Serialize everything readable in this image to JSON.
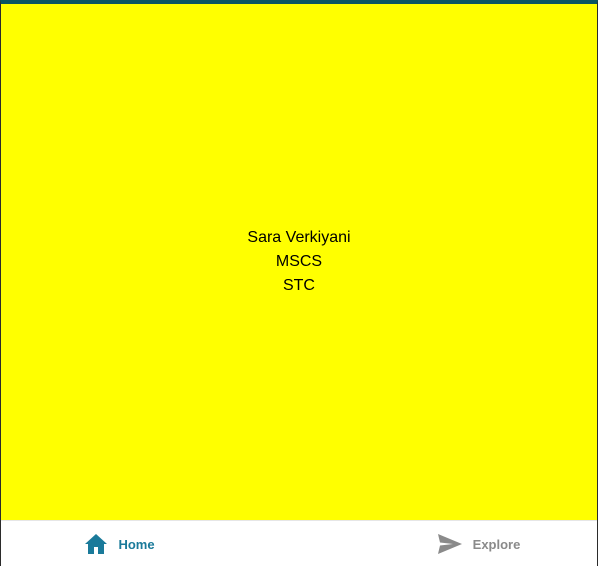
{
  "main": {
    "background_color": "#ffff00",
    "lines": [
      "Sara Verkiyani",
      "MSCS",
      "STC"
    ]
  },
  "tabbar": {
    "active_color": "#1a7a9a",
    "inactive_color": "#8a8a8a",
    "tabs": [
      {
        "label": "Home",
        "icon": "home-icon",
        "active": true
      },
      {
        "label": "Explore",
        "icon": "send-icon",
        "active": false
      }
    ]
  }
}
